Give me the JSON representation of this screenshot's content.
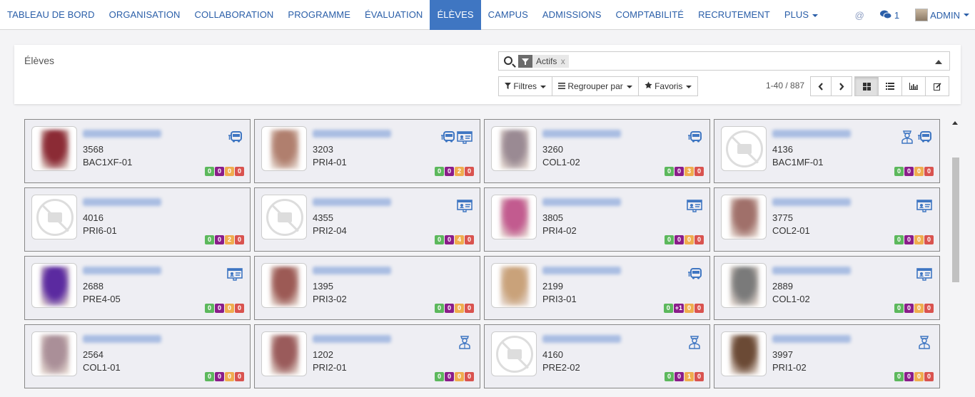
{
  "menu": [
    {
      "label": "TABLEAU DE BORD"
    },
    {
      "label": "ORGANISATION"
    },
    {
      "label": "COLLABORATION"
    },
    {
      "label": "PROGRAMME"
    },
    {
      "label": "ÉVALUATION"
    },
    {
      "label": "ÉLÈVES",
      "active": true
    },
    {
      "label": "CAMPUS"
    },
    {
      "label": "ADMISSIONS"
    },
    {
      "label": "COMPTABILITÉ"
    },
    {
      "label": "RECRUTEMENT"
    },
    {
      "label": "PLUS",
      "dropdown": true
    }
  ],
  "topright": {
    "at_icon": "@",
    "messages_count": "1",
    "user": "ADMIN"
  },
  "page": {
    "title": "Élèves"
  },
  "search": {
    "facet": "Actifs",
    "facet_remove": "x"
  },
  "buttons": {
    "filters": "Filtres",
    "group_by": "Regrouper par",
    "favorites": "Favoris"
  },
  "pager": {
    "text": "1-40 / 887"
  },
  "colors": {
    "accent": "#3f76c2",
    "link": "#2a5ea8",
    "badge_green": "#5cb85c",
    "badge_purple": "#8a1d8a",
    "badge_orange": "#f0ad4e",
    "badge_red": "#d9534f"
  },
  "cards": [
    {
      "id": "3568",
      "class": "BAC1XF-01",
      "photo": "photo",
      "color": "#8b2b35",
      "icons": [
        "bus-icon"
      ],
      "badges": [
        "0",
        "0",
        "0",
        "0"
      ]
    },
    {
      "id": "3203",
      "class": "PRI4-01",
      "photo": "photo",
      "color": "#b07f6e",
      "icons": [
        "bus-icon",
        "id-card-icon"
      ],
      "badges": [
        "0",
        "0",
        "2",
        "0"
      ]
    },
    {
      "id": "3260",
      "class": "COL1-02",
      "photo": "photo",
      "color": "#9a8a93",
      "icons": [
        "bus-icon"
      ],
      "badges": [
        "0",
        "0",
        "3",
        "0"
      ]
    },
    {
      "id": "4136",
      "class": "BAC1MF-01",
      "photo": "none",
      "icons": [
        "driver-icon",
        "bus-icon"
      ],
      "badges": [
        "0",
        "0",
        "0",
        "0"
      ]
    },
    {
      "id": "4016",
      "class": "PRI6-01",
      "photo": "none",
      "icons": [],
      "badges": [
        "0",
        "0",
        "2",
        "0"
      ]
    },
    {
      "id": "4355",
      "class": "PRI2-04",
      "photo": "none",
      "icons": [
        "id-card-icon"
      ],
      "badges": [
        "0",
        "0",
        "4",
        "0"
      ]
    },
    {
      "id": "3805",
      "class": "PRI4-02",
      "photo": "photo",
      "color": "#c25b8f",
      "icons": [
        "id-card-icon"
      ],
      "badges": [
        "0",
        "0",
        "0",
        "0"
      ]
    },
    {
      "id": "3775",
      "class": "COL2-01",
      "photo": "photo",
      "color": "#a0706a",
      "icons": [
        "id-card-icon"
      ],
      "badges": [
        "0",
        "0",
        "0",
        "0"
      ]
    },
    {
      "id": "2688",
      "class": "PRE4-05",
      "photo": "photo",
      "color": "#5b2aa0",
      "icons": [
        "id-card-icon"
      ],
      "badges": [
        "0",
        "0",
        "0",
        "0"
      ]
    },
    {
      "id": "1395",
      "class": "PRI3-02",
      "photo": "photo",
      "color": "#9c5a55",
      "icons": [],
      "badges": [
        "0",
        "0",
        "0",
        "0"
      ]
    },
    {
      "id": "2199",
      "class": "PRI3-01",
      "photo": "photo",
      "color": "#c9a27a",
      "icons": [
        "bus-icon"
      ],
      "badges": [
        "0",
        "+1",
        "0",
        "0"
      ]
    },
    {
      "id": "2889",
      "class": "COL1-02",
      "photo": "photo",
      "color": "#7a7a7a",
      "icons": [
        "id-card-icon"
      ],
      "badges": [
        "0",
        "0",
        "0",
        "0"
      ]
    },
    {
      "id": "2564",
      "class": "COL1-01",
      "photo": "photo",
      "color": "#aa8f98",
      "icons": [],
      "badges": [
        "0",
        "0",
        "0",
        "0"
      ]
    },
    {
      "id": "1202",
      "class": "PRI2-01",
      "photo": "photo",
      "color": "#9a5b5b",
      "icons": [
        "driver-icon"
      ],
      "badges": [
        "0",
        "0",
        "0",
        "0"
      ]
    },
    {
      "id": "4160",
      "class": "PRE2-02",
      "photo": "none",
      "icons": [
        "driver-icon"
      ],
      "badges": [
        "0",
        "0",
        "1",
        "0"
      ]
    },
    {
      "id": "3997",
      "class": "PRI1-02",
      "photo": "photo",
      "color": "#6b4a35",
      "icons": [
        "driver-icon"
      ],
      "badges": [
        "0",
        "0",
        "0",
        "0"
      ]
    }
  ]
}
